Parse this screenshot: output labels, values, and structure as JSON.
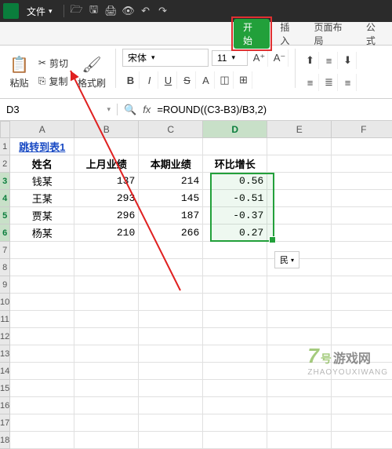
{
  "titlebar": {
    "file_label": "文件"
  },
  "tabs": {
    "start": "开始",
    "insert": "插入",
    "layout": "页面布局",
    "formula": "公式"
  },
  "ribbon": {
    "paste": "粘贴",
    "cut": "剪切",
    "copy": "复制",
    "format_painter": "格式刷",
    "font_name": "宋体",
    "font_size": "11"
  },
  "namebox": {
    "cell": "D3"
  },
  "formula": {
    "text": "=ROUND((C3-B3)/B3,2)"
  },
  "columns": [
    "A",
    "B",
    "C",
    "D",
    "E",
    "F"
  ],
  "headers": {
    "a1": "跳转到表1",
    "a2": "姓名",
    "b2": "上月业绩",
    "c2": "本期业绩",
    "d2": "环比增长"
  },
  "rows": [
    {
      "name": "钱某",
      "prev": "137",
      "cur": "214",
      "growth": "0.56"
    },
    {
      "name": "王某",
      "prev": "293",
      "cur": "145",
      "growth": "-0.51"
    },
    {
      "name": "贾某",
      "prev": "296",
      "cur": "187",
      "growth": "-0.37"
    },
    {
      "name": "杨某",
      "prev": "210",
      "cur": "266",
      "growth": "0.27"
    }
  ],
  "floatbtn": "民",
  "watermark": {
    "num": "7",
    "hao": "号",
    "txt": "游戏网",
    "sub": "ZHAOYOUXIWANG"
  },
  "chart_data": {
    "type": "table",
    "title": "环比增长",
    "columns": [
      "姓名",
      "上月业绩",
      "本期业绩",
      "环比增长"
    ],
    "records": [
      [
        "钱某",
        137,
        214,
        0.56
      ],
      [
        "王某",
        293,
        145,
        -0.51
      ],
      [
        "贾某",
        296,
        187,
        -0.37
      ],
      [
        "杨某",
        210,
        266,
        0.27
      ]
    ],
    "formula": "=ROUND((C3-B3)/B3,2)"
  }
}
